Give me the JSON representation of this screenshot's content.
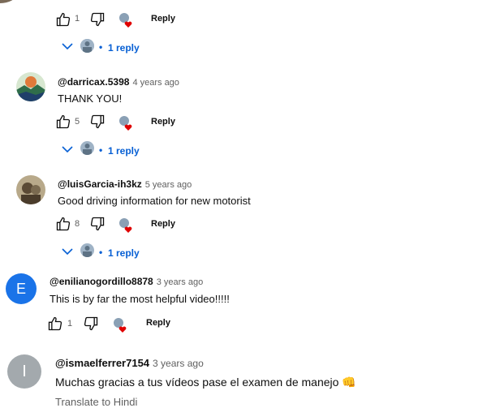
{
  "reply_label": "Reply",
  "replies_label": "1 reply",
  "comments": [
    {
      "likes": "1"
    },
    {
      "handle": "@darricax.5398",
      "time": "4 years ago",
      "text": "THANK YOU!",
      "likes": "5"
    },
    {
      "handle": "@luisGarcia-ih3kz",
      "time": "5 years ago",
      "text": "Good driving information for new motorist",
      "likes": "8"
    },
    {
      "handle": "@enilianogordillo8878",
      "time": "3 years ago",
      "text": "This is by far the most helpful video!!!!!",
      "likes": "1",
      "avatar_letter": "E",
      "avatar_color": "#1a73e8"
    },
    {
      "handle": "@ismaelferrer7154",
      "time": "3 years ago",
      "text": "Muchas gracias a tus vídeos pase el examen de manejo",
      "emoji": "👊",
      "avatar_letter": "I",
      "avatar_color": "#a3a9ad",
      "translate": "Translate to Hindi"
    }
  ],
  "colors": {
    "link": "#065fd4",
    "heart": "#e00000",
    "secondary": "#606060"
  }
}
